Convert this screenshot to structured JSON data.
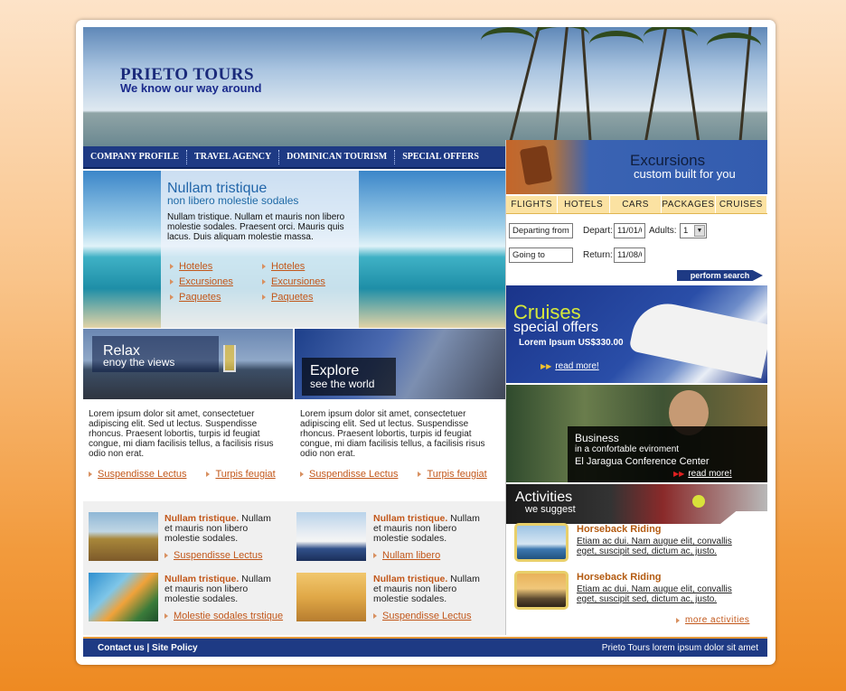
{
  "brand": {
    "name": "PRIETO TOURS",
    "tagline": "We know our way around"
  },
  "nav": [
    "COMPANY PROFILE",
    "TRAVEL AGENCY",
    "DOMINICAN TOURISM",
    "SPECIAL OFFERS"
  ],
  "hero": {
    "title": "Nullam tristique",
    "subtitle": "non libero molestie sodales",
    "text": "Nullam tristique. Nullam et mauris non libero molestie sodales. Praesent orci. Mauris quis lacus. Duis aliquam molestie massa.",
    "links_left": [
      "Hoteles",
      "Excursiones",
      "Paquetes"
    ],
    "links_right": [
      "Hoteles",
      "Excursiones",
      "Paquetes"
    ]
  },
  "relax": {
    "title": "Relax",
    "subtitle": "enoy the views"
  },
  "explore": {
    "title": "Explore",
    "subtitle": "see the world"
  },
  "columns": [
    {
      "text": "Lorem ipsum dolor sit amet, consectetuer adipiscing elit. Sed ut lectus. Suspendisse rhoncus. Praesent lobortis, turpis id feugiat congue, mi diam facilisis tellus, a facilisis risus odio non erat.",
      "links": [
        "Suspendisse Lectus",
        "Turpis feugiat"
      ]
    },
    {
      "text": "Lorem ipsum dolor sit amet, consectetuer adipiscing elit. Sed ut lectus. Suspendisse rhoncus. Praesent lobortis, turpis id feugiat congue, mi diam facilisis tellus, a facilisis risus odio non erat.",
      "links": [
        "Suspendisse Lectus",
        "Turpis feugiat"
      ]
    }
  ],
  "features": [
    {
      "title": "Nullam tristique.",
      "text": " Nullam et mauris non libero molestie sodales.",
      "link": "Suspendisse Lectus"
    },
    {
      "title": "Nullam tristique.",
      "text": " Nullam et mauris non libero molestie sodales.",
      "link": "Nullam libero"
    },
    {
      "title": "Nullam tristique.",
      "text": " Nullam et mauris non libero molestie sodales.",
      "link": "Molestie sodales trstique"
    },
    {
      "title": "Nullam tristique.",
      "text": " Nullam et mauris non libero molestie sodales.",
      "link": "Suspendisse Lectus"
    }
  ],
  "excursions": {
    "title": "Excursions",
    "subtitle": "custom built for you"
  },
  "search": {
    "tabs": [
      "FLIGHTS",
      "HOTELS",
      "CARS",
      "PACKAGES",
      "CRUISES"
    ],
    "departing_value": "Departing from",
    "going_value": "Going to",
    "depart_label": "Depart:",
    "depart_value": "11/01/0",
    "return_label": "Return:",
    "return_value": "11/08/0",
    "adults_label": "Adults:",
    "adults_value": "1",
    "submit": "perform search"
  },
  "cruises": {
    "title": "Cruises",
    "subtitle": "special offers",
    "price": "Lorem Ipsum US$330.00",
    "link": "read more!"
  },
  "business": {
    "title": "Business",
    "line1": "in a confortable eviroment",
    "line2": "El Jaragua Conference Center",
    "link": "read more!"
  },
  "activities": {
    "title": "Activities",
    "subtitle": "we suggest",
    "items": [
      {
        "title": "Horseback Riding",
        "text": "Etiam ac dui. Nam augue elit, convallis eget, suscipit sed, dictum ac, justo."
      },
      {
        "title": "Horseback Riding",
        "text": "Etiam ac dui. Nam augue elit, convallis eget, suscipit sed, dictum ac, justo."
      }
    ],
    "more": "more activities"
  },
  "footer": {
    "left": "Contact us | Site Policy",
    "right": "Prieto Tours lorem ipsum dolor sit amet"
  }
}
